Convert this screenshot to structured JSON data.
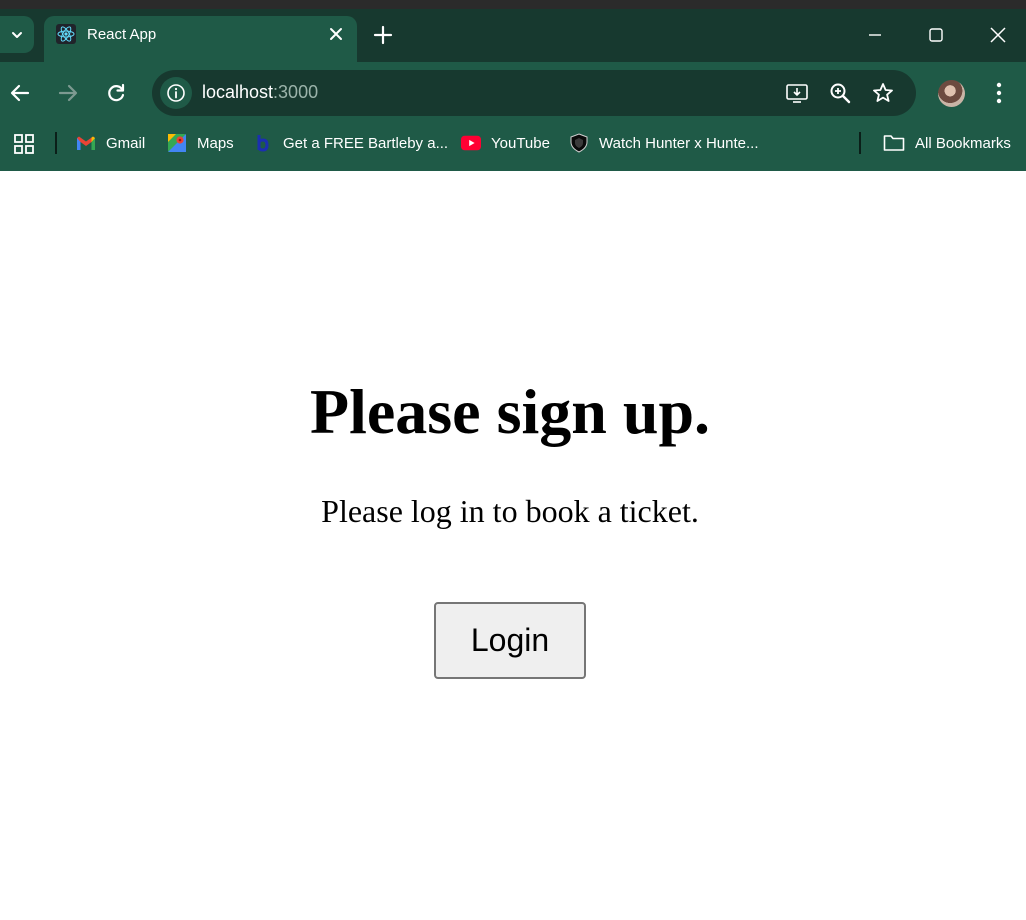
{
  "browser": {
    "tab": {
      "title": "React App",
      "favicon": "react-logo-icon"
    },
    "address": {
      "host": "localhost",
      "port": ":3000"
    },
    "bookmarks": [
      {
        "label": "Gmail",
        "icon": "gmail-icon"
      },
      {
        "label": "Maps",
        "icon": "maps-icon"
      },
      {
        "label": "Get a FREE Bartleby a...",
        "icon": "bartleby-icon"
      },
      {
        "label": "YouTube",
        "icon": "youtube-icon"
      },
      {
        "label": "Watch Hunter x Hunte...",
        "icon": "shield-icon"
      }
    ],
    "all_bookmarks_label": "All Bookmarks"
  },
  "page": {
    "heading": "Please sign up.",
    "message": "Please log in to book a ticket.",
    "login_label": "Login"
  },
  "colors": {
    "titlebar": "#17392f",
    "toolbar": "#1f5a47",
    "page_background": "#ffffff",
    "button_background": "#efefef",
    "button_border": "#767676"
  }
}
